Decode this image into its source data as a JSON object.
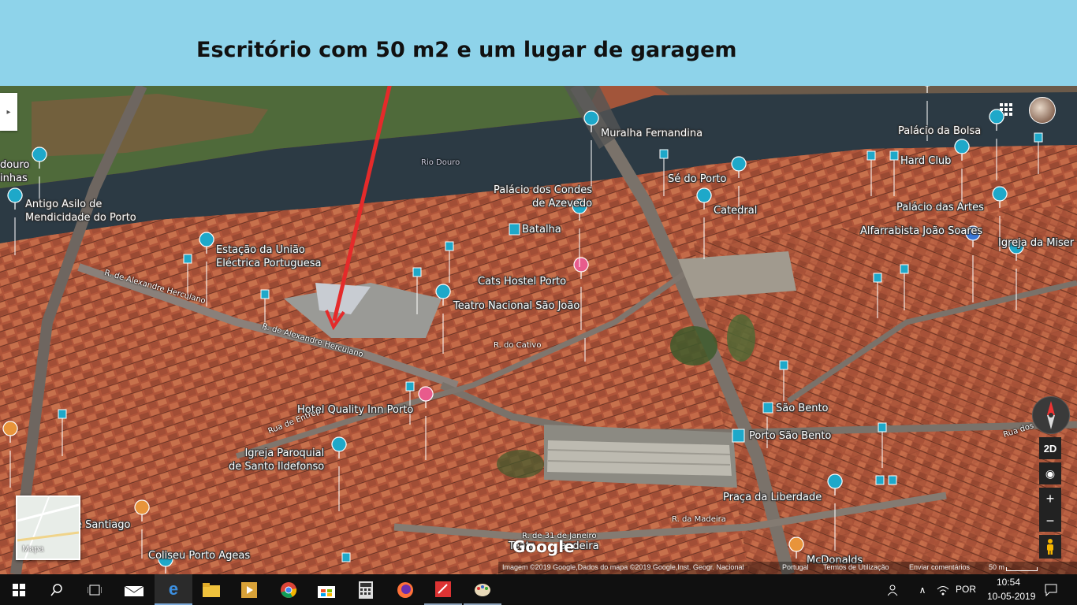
{
  "banner": {
    "title": "Escritório com 50 m2 e um lugar de garagem"
  },
  "map": {
    "poi_labels": {
      "douro_inhas": "douro\ninhas",
      "antigo_asilo": "Antigo Asilo de\nMendicidade do Porto",
      "estacao_uniao": "Estação da União\nEléctrica Portuguesa",
      "muralha": "Muralha Fernandina",
      "palacio_condes": "Palácio dos Condes\nde Azevedo",
      "batalha": "Batalha",
      "cats_hostel": "Cats Hostel Porto",
      "teatro_sao_joao": "Teatro Nacional São João",
      "se_do_porto": "Sé do Porto",
      "catedral": "Catedral",
      "palacio_bolsa": "Palácio da Bolsa",
      "hard_club": "Hard Club",
      "palacio_artes": "Palácio das Artes",
      "alfarrabista": "Alfarrabista João Soares",
      "igreja_miser": "Igreja da Miser",
      "hotel_quality": "Hotel Quality Inn Porto",
      "igreja_ildefonso": "Igreja Paroquial\nde Santo Ildefonso",
      "sao_bento": "São Bento",
      "porto_sao_bento": "Porto São Bento",
      "praca_liberdade": "Praça da Liberdade",
      "santiago": "é Santiago",
      "coliseu": "Coliseu Porto Ageas",
      "teatr_andeira": "Teatr        andeira",
      "mcdonalds": "McDonalds"
    },
    "streets": {
      "rio_douro": "Rio Douro",
      "alexandre1": "R. de Alexandre Herculano",
      "alexandre2": "R. de Alexandre Herculano",
      "do_cativo": "R. do Cativo",
      "de_entreparedes": "Rua de Entrep.",
      "da_madeira": "R. da Madeira",
      "31_janeiro": "R. de 31 de Janeiro",
      "rua_dos": "Rua dos"
    },
    "controls": {
      "two_d": "2D",
      "zoom_in": "+",
      "zoom_out": "−",
      "minimap_label": "Mapa",
      "google_logo": "Google"
    },
    "footer": {
      "imagery": "Imagem ©2019 Google,Dados do mapa ©2019 Google,Inst. Geogr. Nacional",
      "country": "Portugal",
      "terms": "Termos de Utilização",
      "feedback": "Enviar comentários",
      "scale": "50 m"
    },
    "icons": [
      "collapse-panel-icon",
      "apps-grid-icon",
      "user-avatar",
      "compass-icon",
      "locate-icon",
      "pegman-icon"
    ]
  },
  "taskbar": {
    "apps": [
      "start-icon",
      "search-icon",
      "task-view-icon",
      "mail-icon",
      "edge-icon",
      "file-explorer-icon",
      "media-player-icon",
      "chrome-icon",
      "store-icon",
      "calculator-icon",
      "firefox-icon",
      "paint-icon",
      "paint-palette-icon"
    ],
    "language": "POR",
    "time": "10:54",
    "date": "10-05-2019"
  },
  "colors": {
    "banner": "#8ed3ea",
    "river": "#2c3a44",
    "roofs": "#b4573a",
    "poi": "#1ea8c9",
    "arrow": "#e52a2a"
  }
}
